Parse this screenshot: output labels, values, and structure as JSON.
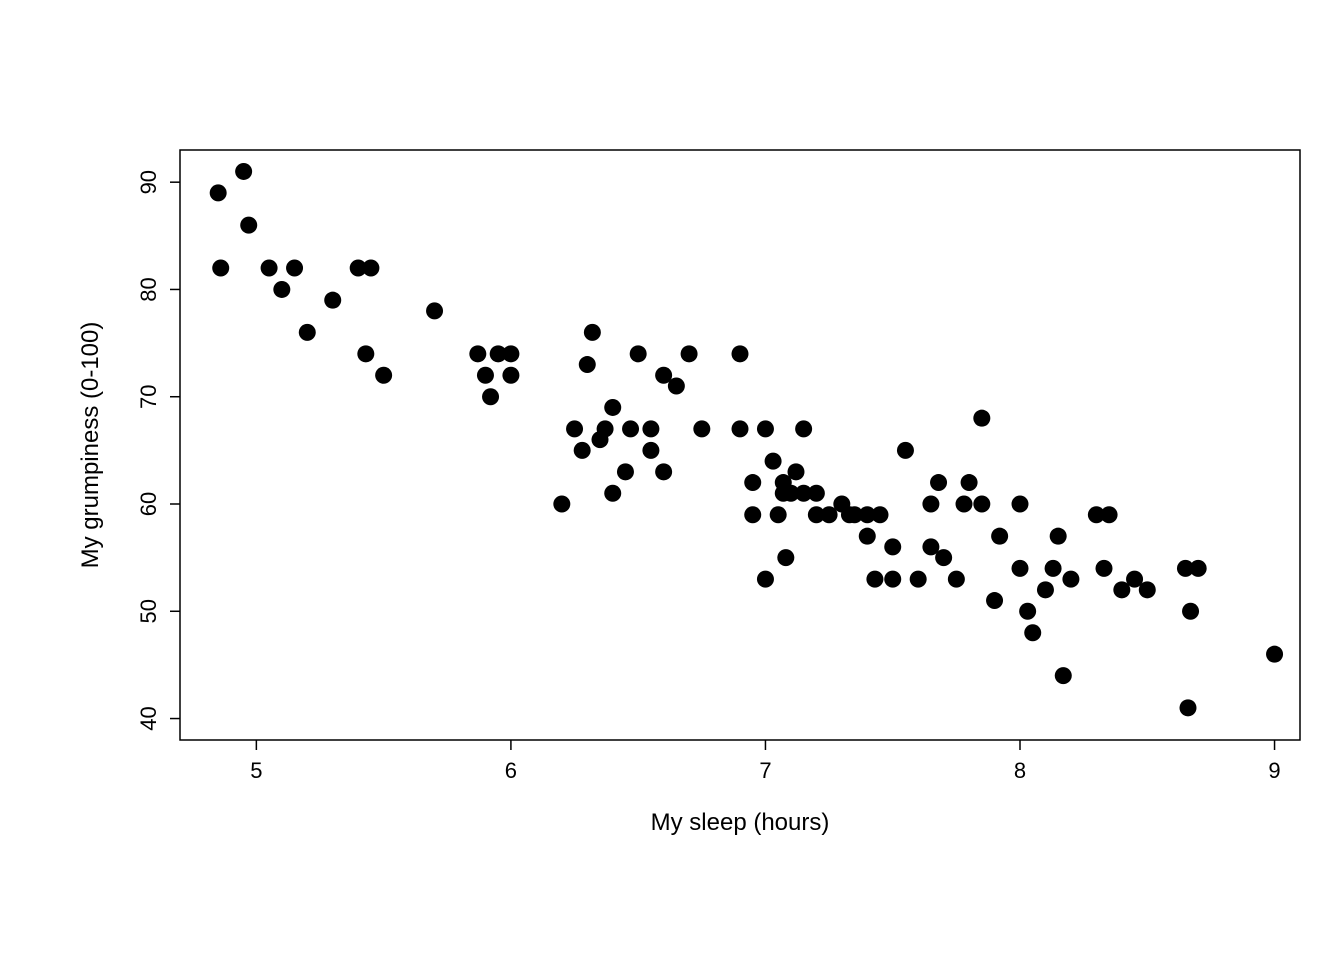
{
  "chart_data": {
    "type": "scatter",
    "xlabel": "My sleep (hours)",
    "ylabel": "My grumpiness (0-100)",
    "title": "",
    "xlim": [
      4.7,
      9.1
    ],
    "ylim": [
      38,
      93
    ],
    "xticks": [
      5,
      6,
      7,
      8,
      9
    ],
    "yticks": [
      40,
      50,
      60,
      70,
      80,
      90
    ],
    "points": [
      {
        "x": 4.85,
        "y": 89
      },
      {
        "x": 4.86,
        "y": 82
      },
      {
        "x": 4.95,
        "y": 91
      },
      {
        "x": 4.97,
        "y": 86
      },
      {
        "x": 5.05,
        "y": 82
      },
      {
        "x": 5.1,
        "y": 80
      },
      {
        "x": 5.15,
        "y": 82
      },
      {
        "x": 5.2,
        "y": 76
      },
      {
        "x": 5.3,
        "y": 79
      },
      {
        "x": 5.4,
        "y": 82
      },
      {
        "x": 5.43,
        "y": 74
      },
      {
        "x": 5.45,
        "y": 82
      },
      {
        "x": 5.5,
        "y": 72
      },
      {
        "x": 5.7,
        "y": 78
      },
      {
        "x": 5.87,
        "y": 74
      },
      {
        "x": 5.9,
        "y": 72
      },
      {
        "x": 5.92,
        "y": 70
      },
      {
        "x": 5.95,
        "y": 74
      },
      {
        "x": 6.0,
        "y": 72
      },
      {
        "x": 6.0,
        "y": 74
      },
      {
        "x": 6.2,
        "y": 60
      },
      {
        "x": 6.25,
        "y": 67
      },
      {
        "x": 6.28,
        "y": 65
      },
      {
        "x": 6.3,
        "y": 73
      },
      {
        "x": 6.32,
        "y": 76
      },
      {
        "x": 6.35,
        "y": 66
      },
      {
        "x": 6.37,
        "y": 67
      },
      {
        "x": 6.4,
        "y": 69
      },
      {
        "x": 6.4,
        "y": 61
      },
      {
        "x": 6.45,
        "y": 63
      },
      {
        "x": 6.47,
        "y": 67
      },
      {
        "x": 6.5,
        "y": 74
      },
      {
        "x": 6.55,
        "y": 67
      },
      {
        "x": 6.55,
        "y": 65
      },
      {
        "x": 6.6,
        "y": 72
      },
      {
        "x": 6.6,
        "y": 63
      },
      {
        "x": 6.65,
        "y": 71
      },
      {
        "x": 6.7,
        "y": 74
      },
      {
        "x": 6.75,
        "y": 67
      },
      {
        "x": 6.9,
        "y": 74
      },
      {
        "x": 6.9,
        "y": 67
      },
      {
        "x": 6.95,
        "y": 62
      },
      {
        "x": 6.95,
        "y": 59
      },
      {
        "x": 7.0,
        "y": 67
      },
      {
        "x": 7.0,
        "y": 53
      },
      {
        "x": 7.03,
        "y": 64
      },
      {
        "x": 7.05,
        "y": 59
      },
      {
        "x": 7.07,
        "y": 61
      },
      {
        "x": 7.07,
        "y": 62
      },
      {
        "x": 7.08,
        "y": 55
      },
      {
        "x": 7.1,
        "y": 61
      },
      {
        "x": 7.12,
        "y": 63
      },
      {
        "x": 7.15,
        "y": 67
      },
      {
        "x": 7.15,
        "y": 61
      },
      {
        "x": 7.2,
        "y": 59
      },
      {
        "x": 7.2,
        "y": 61
      },
      {
        "x": 7.25,
        "y": 59
      },
      {
        "x": 7.3,
        "y": 60
      },
      {
        "x": 7.33,
        "y": 59
      },
      {
        "x": 7.35,
        "y": 59
      },
      {
        "x": 7.4,
        "y": 57
      },
      {
        "x": 7.4,
        "y": 59
      },
      {
        "x": 7.43,
        "y": 53
      },
      {
        "x": 7.45,
        "y": 59
      },
      {
        "x": 7.5,
        "y": 56
      },
      {
        "x": 7.5,
        "y": 53
      },
      {
        "x": 7.55,
        "y": 65
      },
      {
        "x": 7.6,
        "y": 53
      },
      {
        "x": 7.65,
        "y": 60
      },
      {
        "x": 7.65,
        "y": 56
      },
      {
        "x": 7.68,
        "y": 62
      },
      {
        "x": 7.7,
        "y": 55
      },
      {
        "x": 7.75,
        "y": 53
      },
      {
        "x": 7.78,
        "y": 60
      },
      {
        "x": 7.8,
        "y": 62
      },
      {
        "x": 7.85,
        "y": 68
      },
      {
        "x": 7.85,
        "y": 60
      },
      {
        "x": 7.9,
        "y": 51
      },
      {
        "x": 7.92,
        "y": 57
      },
      {
        "x": 8.0,
        "y": 54
      },
      {
        "x": 8.0,
        "y": 60
      },
      {
        "x": 8.03,
        "y": 50
      },
      {
        "x": 8.05,
        "y": 48
      },
      {
        "x": 8.1,
        "y": 52
      },
      {
        "x": 8.13,
        "y": 54
      },
      {
        "x": 8.15,
        "y": 57
      },
      {
        "x": 8.17,
        "y": 44
      },
      {
        "x": 8.2,
        "y": 53
      },
      {
        "x": 8.3,
        "y": 59
      },
      {
        "x": 8.33,
        "y": 54
      },
      {
        "x": 8.35,
        "y": 59
      },
      {
        "x": 8.4,
        "y": 52
      },
      {
        "x": 8.45,
        "y": 53
      },
      {
        "x": 8.5,
        "y": 52
      },
      {
        "x": 8.65,
        "y": 54
      },
      {
        "x": 8.66,
        "y": 41
      },
      {
        "x": 8.67,
        "y": 50
      },
      {
        "x": 8.7,
        "y": 54
      },
      {
        "x": 9.0,
        "y": 46
      }
    ]
  }
}
